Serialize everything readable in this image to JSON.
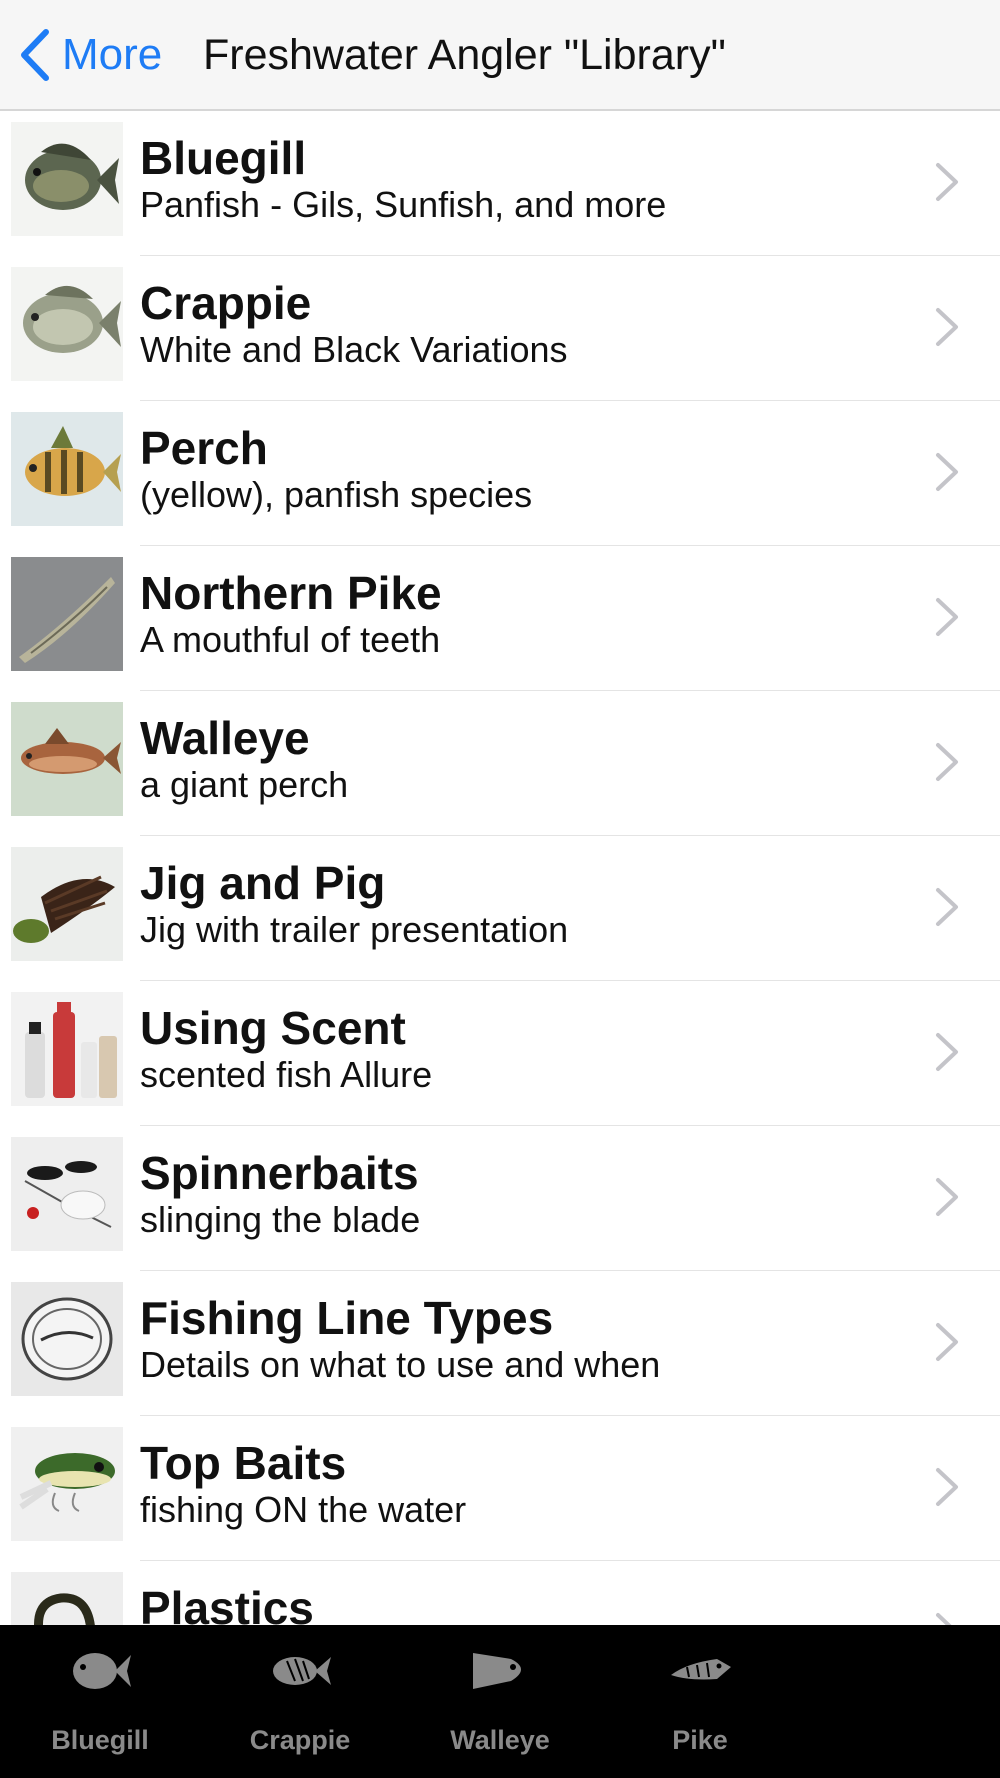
{
  "nav": {
    "back_label": "More",
    "title": "Freshwater Angler \"Library\""
  },
  "colors": {
    "accent": "#1e7cf5",
    "tabbar_bg": "#000000",
    "tab_label": "#8a8a8a"
  },
  "list": [
    {
      "title": "Bluegill",
      "subtitle": "Panfish - Gils, Sunfish, and more",
      "icon": "bluegill-thumbnail"
    },
    {
      "title": "Crappie",
      "subtitle": "White and Black Variations",
      "icon": "crappie-thumbnail"
    },
    {
      "title": "Perch",
      "subtitle": "(yellow), panfish species",
      "icon": "perch-thumbnail"
    },
    {
      "title": "Northern Pike",
      "subtitle": "A mouthful of teeth",
      "icon": "northern-pike-thumbnail"
    },
    {
      "title": "Walleye",
      "subtitle": "a giant perch",
      "icon": "walleye-thumbnail"
    },
    {
      "title": "Jig and Pig",
      "subtitle": "Jig with trailer presentation",
      "icon": "jig-thumbnail"
    },
    {
      "title": "Using Scent",
      "subtitle": "scented fish Allure",
      "icon": "scent-bottles-thumbnail"
    },
    {
      "title": "Spinnerbaits",
      "subtitle": "slinging the blade",
      "icon": "spinnerbait-thumbnail"
    },
    {
      "title": "Fishing Line Types",
      "subtitle": "Details on what to use and when",
      "icon": "line-spool-thumbnail"
    },
    {
      "title": "Top Baits",
      "subtitle": "fishing ON the water",
      "icon": "topwater-lure-thumbnail"
    },
    {
      "title": "Plastics",
      "subtitle": "",
      "icon": "plastic-worm-thumbnail"
    }
  ],
  "tabs": [
    {
      "label": "Bluegill",
      "icon": "bluegill-icon"
    },
    {
      "label": "Crappie",
      "icon": "crappie-icon"
    },
    {
      "label": "Walleye",
      "icon": "walleye-icon"
    },
    {
      "label": "Pike",
      "icon": "pike-icon"
    }
  ]
}
